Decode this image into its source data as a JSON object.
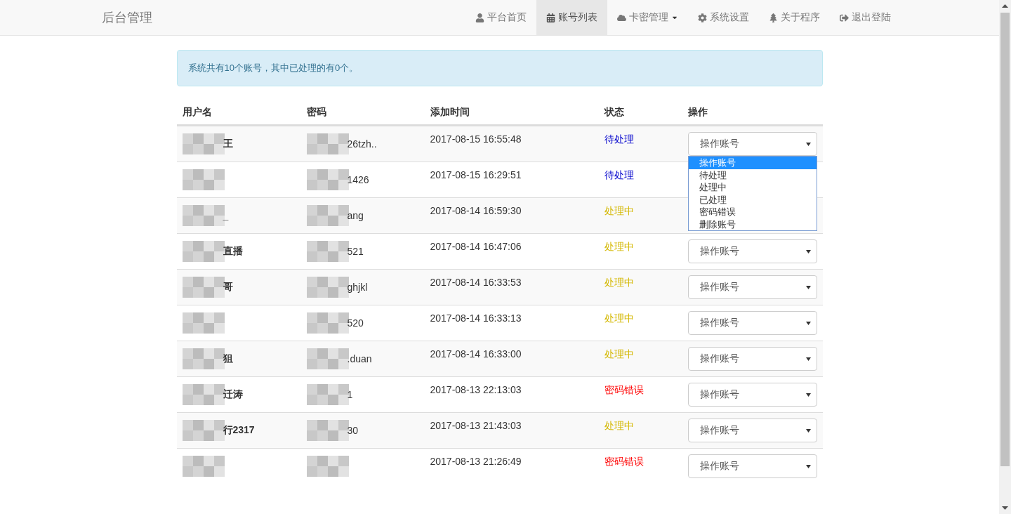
{
  "navbar": {
    "brand": "后台管理",
    "items": [
      {
        "label": "平台首页",
        "selected": false
      },
      {
        "label": "账号列表",
        "selected": true
      },
      {
        "label": "卡密管理",
        "selected": false,
        "dropdown": true
      },
      {
        "label": "系统设置",
        "selected": false
      },
      {
        "label": "关于程序",
        "selected": false
      },
      {
        "label": "退出登陆",
        "selected": false
      }
    ]
  },
  "alert": "系统共有10个账号，其中已处理的有0个。",
  "table": {
    "columns": [
      "用户名",
      "密码",
      "添加时间",
      "状态",
      "操作"
    ],
    "rows": [
      {
        "username": "王",
        "password": "26tzh..",
        "time": "2017-08-15 16:55:48",
        "status": "待处理",
        "color": "#0000cc",
        "select": "操作账号",
        "dropdown": {
          "options": [
            {
              "label": "操作账号",
              "selected": true
            },
            {
              "label": "待处理",
              "selected": false
            },
            {
              "label": "处理中",
              "selected": false
            },
            {
              "label": "已处理",
              "selected": false
            },
            {
              "label": "密码错误",
              "selected": false
            },
            {
              "label": "删除账号",
              "selected": false
            }
          ]
        }
      },
      {
        "password": "1426",
        "time": "2017-08-15 16:29:51",
        "status": "待处理",
        "color": "#0000cc"
      },
      {
        "username": "_",
        "password": "ang",
        "time": "2017-08-14 16:59:30",
        "status": "处理中",
        "color": "#d4b800"
      },
      {
        "username": "直播",
        "password": "521",
        "time": "2017-08-14 16:47:06",
        "status": "处理中",
        "color": "#d4b800",
        "select": "操作账号"
      },
      {
        "username": "哥",
        "password": "ghjkl",
        "time": "2017-08-14 16:33:53",
        "status": "处理中",
        "color": "#d4b800",
        "select": "操作账号"
      },
      {
        "password": "520",
        "time": "2017-08-14 16:33:13",
        "status": "处理中",
        "color": "#d4b800",
        "select": "操作账号"
      },
      {
        "username": "狙",
        "password": ".duan",
        "time": "2017-08-14 16:33:00",
        "status": "处理中",
        "color": "#d4b800",
        "select": "操作账号"
      },
      {
        "username": "迁涛",
        "password": "1",
        "time": "2017-08-13 22:13:03",
        "status": "密码错误",
        "color": "#ff0000",
        "select": "操作账号"
      },
      {
        "username": "行2317",
        "password": "30",
        "time": "2017-08-13 21:43:03",
        "status": "处理中",
        "color": "#d4b800",
        "select": "操作账号"
      },
      {
        "time": "2017-08-13 21:26:49",
        "status": "密码错误",
        "color": "#ff0000",
        "select": "操作账号"
      }
    ]
  }
}
